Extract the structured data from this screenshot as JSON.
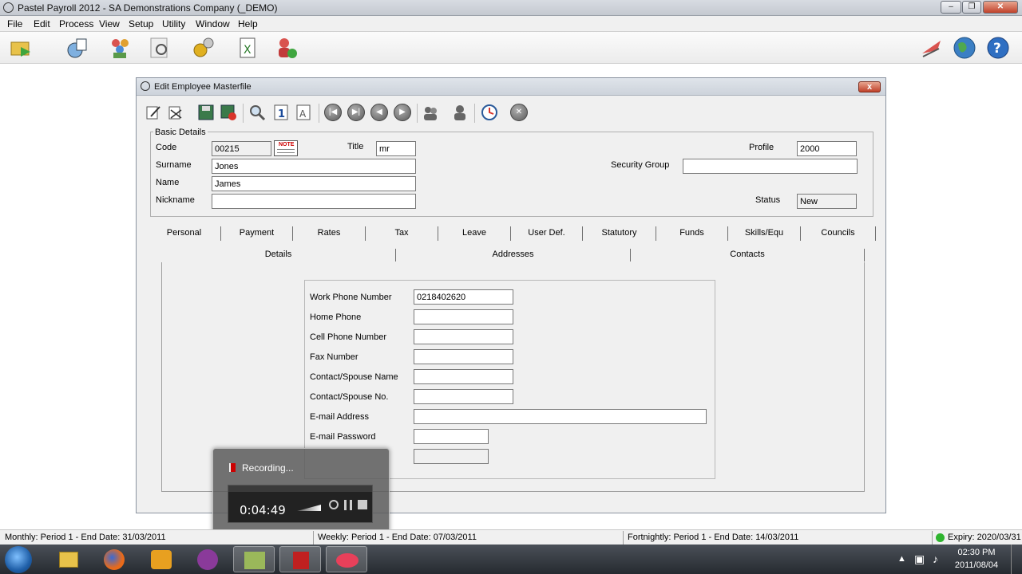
{
  "app": {
    "title": "Pastel Payroll 2012 - SA Demonstrations Company (_DEMO)",
    "menu": [
      "File",
      "Edit",
      "Process",
      "View",
      "Setup",
      "Utility",
      "Window",
      "Help"
    ],
    "toolbar_icons": [
      "open-icon",
      "backup-icon",
      "employees-icon",
      "search-icon",
      "setup-gears-icon",
      "excel-export-icon",
      "user-info-icon"
    ],
    "right_icons": [
      "pastel-logo-icon",
      "globe-icon",
      "help-icon"
    ]
  },
  "dialog": {
    "title": "Edit Employee Masterfile",
    "close": "x",
    "toolbar_icons": [
      "edit-icon",
      "edit-all-icon",
      "save-icon",
      "save-close-icon",
      "search-icon",
      "info-icon",
      "text-icon",
      "first-record-icon",
      "previous-record-icon",
      "next-record-icon",
      "last-record-icon",
      "people-icon",
      "person-icon",
      "calendar-clock-icon",
      "close-circle-icon"
    ],
    "basic_details": {
      "legend": "Basic Details",
      "code_label": "Code",
      "code_value": "00215",
      "note_label": "NOTE",
      "title_label": "Title",
      "title_value": "mr",
      "surname_label": "Surname",
      "surname_value": "Jones",
      "name_label": "Name",
      "name_value": "James",
      "nickname_label": "Nickname",
      "nickname_value": "",
      "profile_label": "Profile",
      "profile_value": "2000",
      "security_group_label": "Security Group",
      "security_group_value": "",
      "status_label": "Status",
      "status_value": "New"
    },
    "tabs": [
      "Personal",
      "Payment",
      "Rates",
      "Tax",
      "Leave",
      "User Def.",
      "Statutory",
      "Funds",
      "Skills/Equ",
      "Councils"
    ],
    "subtabs": [
      "Details",
      "Addresses",
      "Contacts"
    ],
    "contacts": {
      "work_phone_label": "Work Phone Number",
      "work_phone_value": "0218402620",
      "home_phone_label": "Home Phone",
      "home_phone_value": "",
      "cell_phone_label": "Cell Phone Number",
      "cell_phone_value": "",
      "fax_label": "Fax Number",
      "fax_value": "",
      "spouse_name_label": "Contact/Spouse Name",
      "spouse_name_value": "",
      "spouse_no_label": "Contact/Spouse No.",
      "spouse_no_value": "",
      "email_label": "E-mail Address",
      "email_value": "",
      "email_password_label": "E-mail Password",
      "email_password_value": ""
    }
  },
  "recorder": {
    "title": "Recording...",
    "time": "0:04:49"
  },
  "statusbar": {
    "monthly": "Monthly: Period 1 - End Date: 31/03/2011",
    "weekly": "Weekly: Period 1 - End Date: 07/03/2011",
    "fortnightly": "Fortnightly: Period 1 - End Date: 14/03/2011",
    "expiry": "Expiry: 2020/03/31"
  },
  "taskbar": {
    "time": "02:30 PM",
    "date": "2011/08/04"
  },
  "colors": {
    "expiry_dot": "#2fb52f",
    "dialog_bg": "#f0f0f0",
    "taskbar": "#2e3238"
  }
}
